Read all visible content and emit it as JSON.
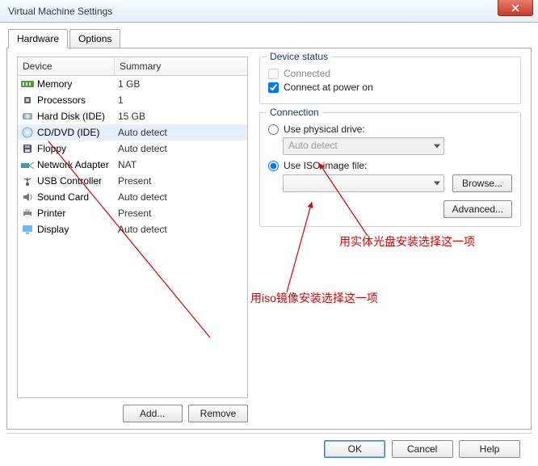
{
  "title": "Virtual Machine Settings",
  "tabs": {
    "hardware": "Hardware",
    "options": "Options"
  },
  "list_head": {
    "device": "Device",
    "summary": "Summary"
  },
  "devices": [
    {
      "name": "Memory",
      "summary": "1 GB"
    },
    {
      "name": "Processors",
      "summary": "1"
    },
    {
      "name": "Hard Disk (IDE)",
      "summary": "15 GB"
    },
    {
      "name": "CD/DVD (IDE)",
      "summary": "Auto detect"
    },
    {
      "name": "Floppy",
      "summary": "Auto detect"
    },
    {
      "name": "Network Adapter",
      "summary": "NAT"
    },
    {
      "name": "USB Controller",
      "summary": "Present"
    },
    {
      "name": "Sound Card",
      "summary": "Auto detect"
    },
    {
      "name": "Printer",
      "summary": "Present"
    },
    {
      "name": "Display",
      "summary": "Auto detect"
    }
  ],
  "buttons": {
    "add": "Add...",
    "remove": "Remove",
    "browse": "Browse...",
    "advanced": "Advanced...",
    "ok": "OK",
    "cancel": "Cancel",
    "help": "Help"
  },
  "device_status": {
    "legend": "Device status",
    "connected": "Connected",
    "connect_power": "Connect at power on"
  },
  "connection": {
    "legend": "Connection",
    "physical": "Use physical drive:",
    "physical_value": "Auto detect",
    "iso": "Use ISO image file:",
    "iso_value": ""
  },
  "annotations": {
    "a1": "用实体光盘安装选择这一项",
    "a2": "用iso镜像安装选择这一项"
  }
}
